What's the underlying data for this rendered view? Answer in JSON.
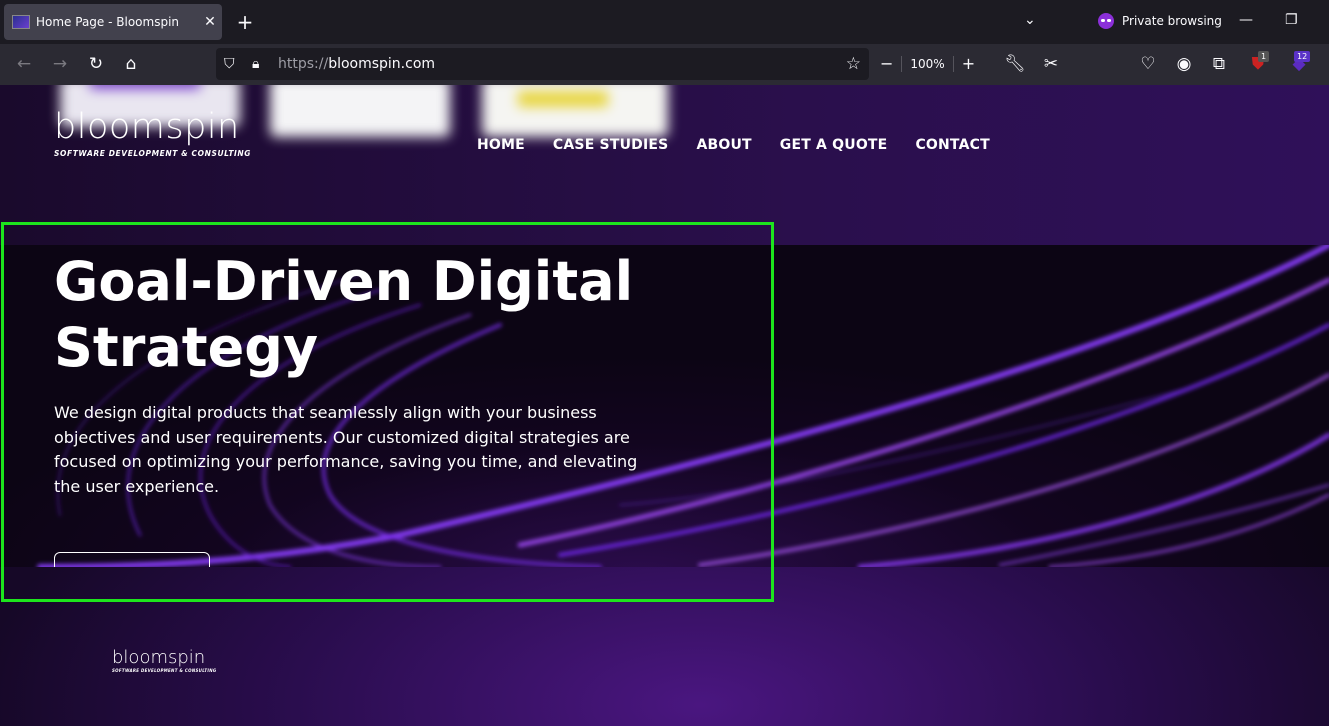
{
  "browser": {
    "tab_title": "Home Page - Bloomspin",
    "new_tab_label": "+",
    "private_label": "Private browsing",
    "url_scheme": "https://",
    "url_host": "bloomspin.com",
    "zoom_level": "100%",
    "extension_badges": [
      "1",
      "12"
    ]
  },
  "site": {
    "logo_name": "bloomspin",
    "logo_tagline": "SOFTWARE DEVELOPMENT & CONSULTING",
    "nav": [
      "HOME",
      "CASE STUDIES",
      "ABOUT",
      "GET A QUOTE",
      "CONTACT"
    ]
  },
  "hero": {
    "title_line1": "Goal-Driven Digital",
    "title_line2": "Strategy",
    "description": "We design digital products that seamlessly align with your business objectives and user requirements. Our customized digital strategies are focused on optimizing your performance, saving you time, and elevating the user experience."
  },
  "footer": {
    "logo_name": "bloomspin",
    "logo_tagline": "SOFTWARE DEVELOPMENT & CONSULTING"
  },
  "colors": {
    "highlight": "#1de51d",
    "accent": "#7a2cff"
  }
}
